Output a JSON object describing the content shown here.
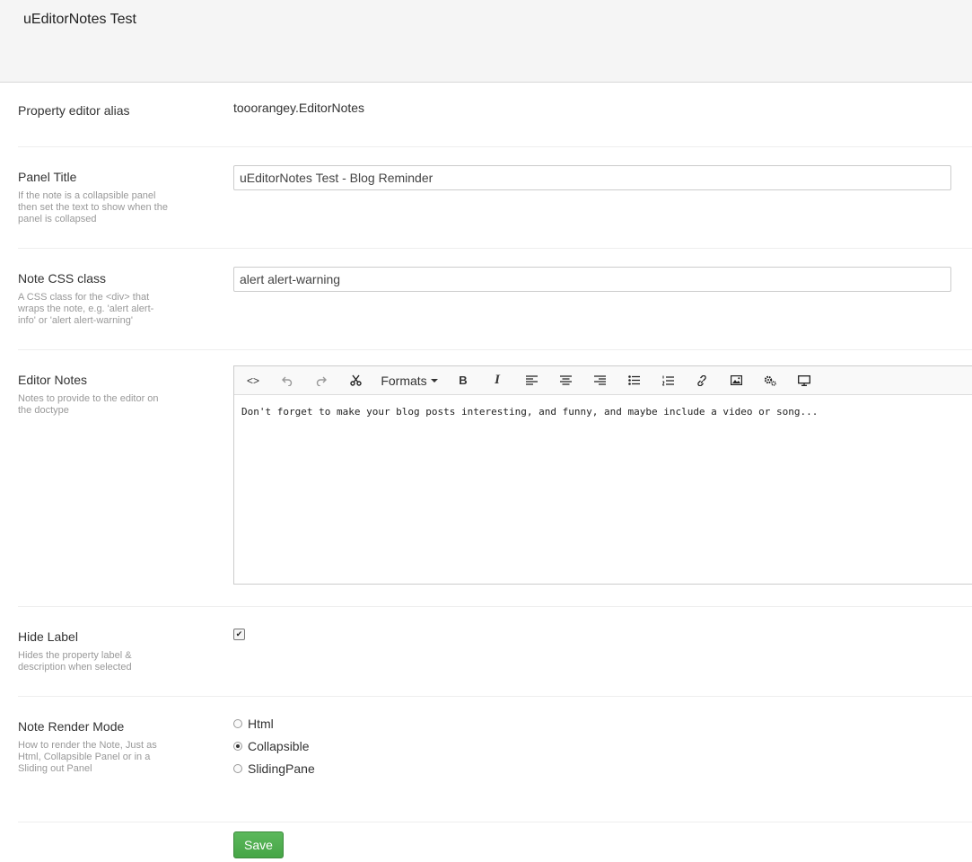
{
  "header": {
    "title": "uEditorNotes Test"
  },
  "alias": {
    "label": "Property editor alias",
    "value": "tooorangey.EditorNotes"
  },
  "panel_title": {
    "label": "Panel Title",
    "description": "If the note is a collapsible panel then set the text to show when the panel is collapsed",
    "value": "uEditorNotes Test - Blog Reminder"
  },
  "note_css": {
    "label": "Note CSS class",
    "description": "A CSS class for the <div> that wraps the note, e.g. 'alert alert-info' or 'alert alert-warning'",
    "value": "alert alert-warning"
  },
  "editor_notes": {
    "label": "Editor Notes",
    "description": "Notes to provide to the editor on the doctype",
    "toolbar": {
      "source_icon": "<>",
      "formats_label": "Formats",
      "bold": "B",
      "italic": "I"
    },
    "content": "Don't forget to make your blog posts interesting, and funny, and maybe include a video or song..."
  },
  "hide_label": {
    "label": "Hide Label",
    "description": "Hides the property label & description when selected",
    "checked": true
  },
  "render_mode": {
    "label": "Note Render Mode",
    "description": "How to render the Note, Just as Html, Collapsible Panel or in a Sliding out Panel",
    "options": [
      "Html",
      "Collapsible",
      "SlidingPane"
    ],
    "selected": "Collapsible"
  },
  "actions": {
    "save_label": "Save"
  }
}
